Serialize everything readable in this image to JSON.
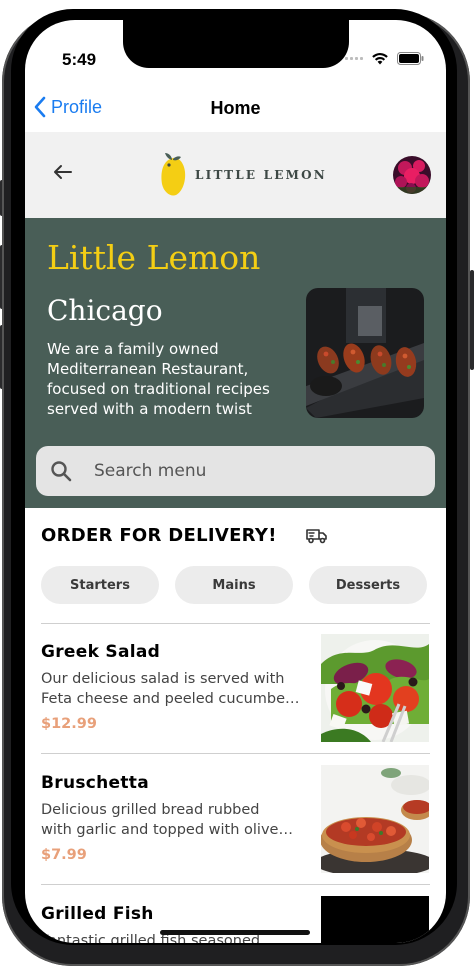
{
  "status": {
    "time": "5:49"
  },
  "nav": {
    "back_label": "Profile",
    "title": "Home"
  },
  "header": {
    "logo_text": "LITTLE LEMON"
  },
  "hero": {
    "title": "Little Lemon",
    "city": "Chicago",
    "description": "We are a family owned Mediterranean Restaurant, focused on traditional recipes served with a modern twist"
  },
  "search": {
    "placeholder": "Search menu"
  },
  "order": {
    "title": "ORDER FOR DELIVERY!",
    "categories": [
      "Starters",
      "Mains",
      "Desserts"
    ]
  },
  "menu": [
    {
      "name": "Greek Salad",
      "desc_line1": "Our delicious salad is served with",
      "desc_line2": "Feta cheese and peeled cucumbe…",
      "price": "$12.99"
    },
    {
      "name": "Bruschetta",
      "desc_line1": "Delicious grilled bread rubbed",
      "desc_line2": "with garlic and topped with olive…",
      "price": "$7.99"
    },
    {
      "name": "Grilled Fish",
      "desc_line1": "Fantastic grilled fish seasoned",
      "desc_line2": "",
      "price": ""
    }
  ],
  "colors": {
    "primary_green": "#495e57",
    "primary_yellow": "#f4ce14",
    "price_color": "#e8a07a",
    "ios_blue": "#1a7cf0"
  }
}
